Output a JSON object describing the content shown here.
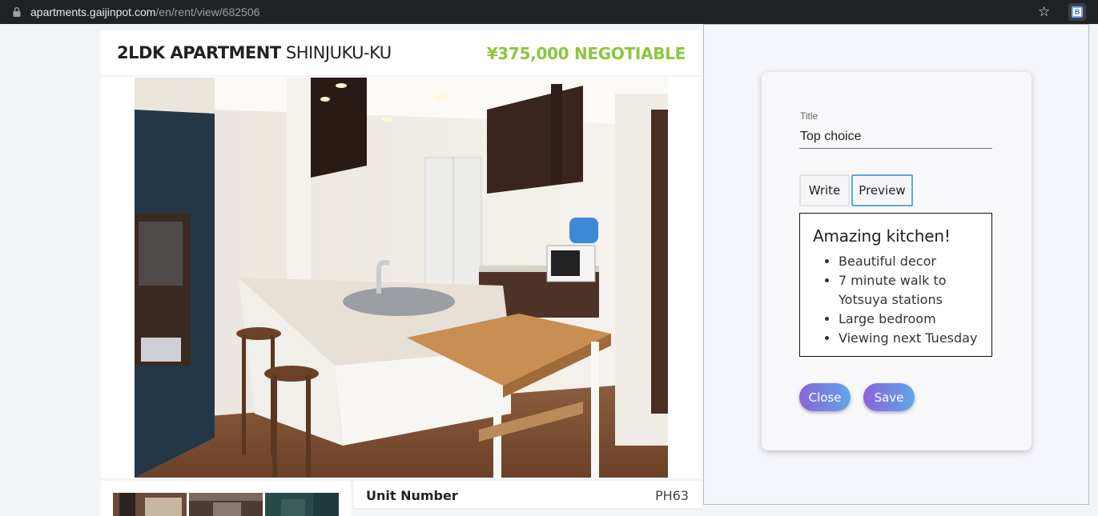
{
  "browser": {
    "url_host": "apartments.gaijinpot.com",
    "url_path": "/en/rent/view/682506",
    "icons": {
      "lock": "lock-icon",
      "bookmark": "star-icon",
      "extension": "extension-icon"
    },
    "extension_letter": "B"
  },
  "listing": {
    "type_bold": "2LDK APARTMENT",
    "location": "SHINJUKU-KU",
    "price": "¥375,000 NEGOTIABLE",
    "price_color": "#8cc63f",
    "details": [
      {
        "label": "Unit Number",
        "value": "PH63"
      }
    ]
  },
  "note_editor": {
    "title_label": "Title",
    "title_value": "Top choice",
    "tabs": [
      {
        "label": "Write",
        "active": false
      },
      {
        "label": "Preview",
        "active": true
      }
    ],
    "preview": {
      "heading": "Amazing kitchen!",
      "items": [
        "Beautiful decor",
        "7 minute walk to Yotsuya stations",
        "Large bedroom",
        "Viewing next Tuesday"
      ]
    },
    "buttons": {
      "close": "Close",
      "save": "Save"
    },
    "accent_gradient": [
      "#8b63d9",
      "#5fa6ea"
    ]
  }
}
